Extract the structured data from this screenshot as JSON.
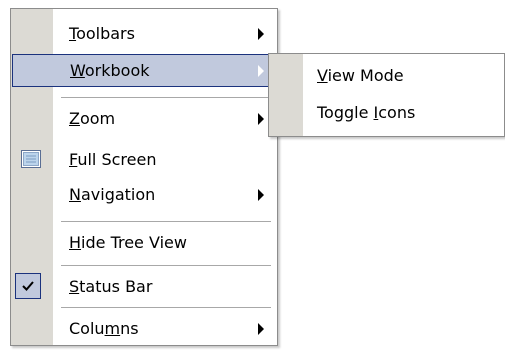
{
  "main_menu": {
    "items": [
      {
        "pre": "",
        "ul": "T",
        "post": "oolbars"
      },
      {
        "pre": "",
        "ul": "W",
        "post": "orkbook"
      },
      {
        "pre": "",
        "ul": "Z",
        "post": "oom"
      },
      {
        "pre": "",
        "ul": "F",
        "post": "ull Screen"
      },
      {
        "pre": "",
        "ul": "N",
        "post": "avigation"
      },
      {
        "pre": "",
        "ul": "H",
        "post": "ide Tree View"
      },
      {
        "pre": "",
        "ul": "S",
        "post": "tatus Bar"
      },
      {
        "pre": "Colu",
        "ul": "m",
        "post": "ns"
      }
    ]
  },
  "sub_menu": {
    "items": [
      {
        "pre": "",
        "ul": "V",
        "post": "iew Mode"
      },
      {
        "pre": "Toggle ",
        "ul": "I",
        "post": "cons"
      }
    ]
  },
  "colors": {
    "gutter": "#dcdad4",
    "highlight_fill": "#c1c9dd",
    "highlight_border": "#1b327d"
  }
}
